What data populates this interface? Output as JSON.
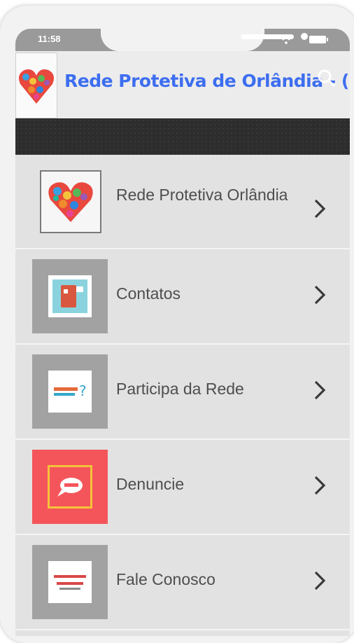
{
  "status_bar": {
    "time": "11:58"
  },
  "app_bar": {
    "title": "Rede Protetiva de Orlândia - (P.?"
  },
  "menu": {
    "items": [
      {
        "label": "Rede Protetiva Orlândia",
        "icon": "heart-icon"
      },
      {
        "label": "Contatos",
        "icon": "contact-book-icon"
      },
      {
        "label": "Participa da Rede",
        "icon": "question-sign-icon"
      },
      {
        "label": "Denuncie",
        "icon": "speech-bubble-icon"
      },
      {
        "label": "Fale Conosco",
        "icon": "contact-card-icon"
      }
    ]
  },
  "colors": {
    "title": "#3d6ef0",
    "accent_red": "#f4555b",
    "banner": "#2d2d2d"
  }
}
